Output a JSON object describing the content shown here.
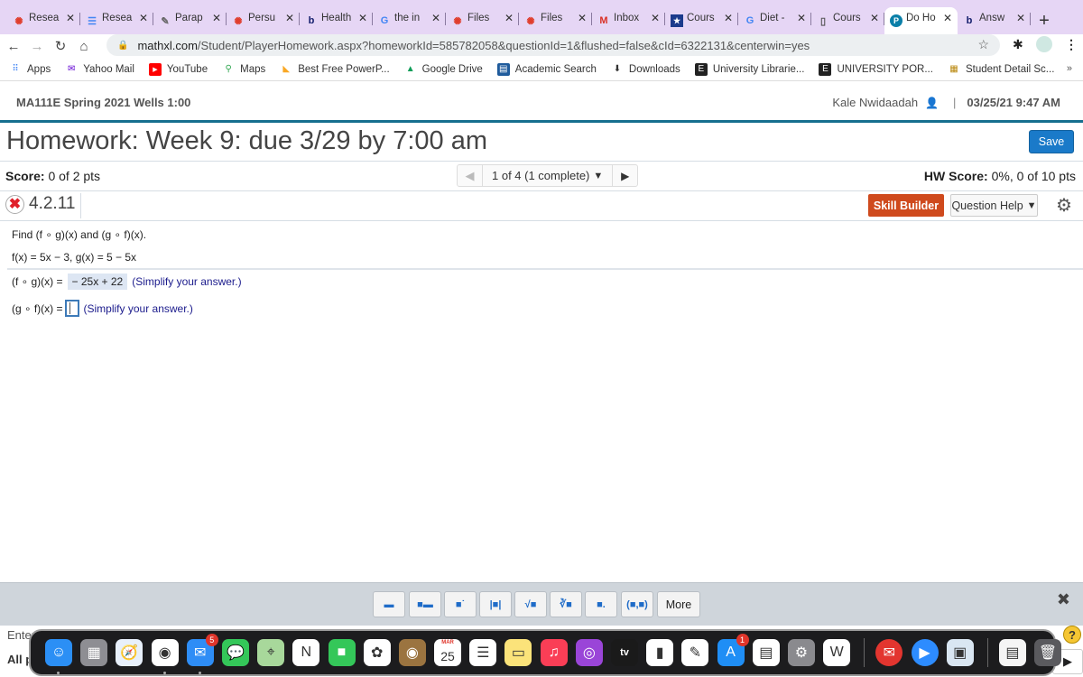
{
  "browser": {
    "tabs": [
      {
        "label": "Resea",
        "icon": "canvas-icon",
        "icon_color": "#e03e2d",
        "active": false
      },
      {
        "label": "Resea",
        "icon": "google-docs-icon",
        "icon_color": "#4285f4",
        "active": false
      },
      {
        "label": "Parap",
        "icon": "quill-icon",
        "icon_color": "#666666",
        "active": false
      },
      {
        "label": "Persu",
        "icon": "canvas-icon",
        "icon_color": "#e03e2d",
        "active": false
      },
      {
        "label": "Health",
        "icon": "bartleby-icon",
        "icon_color": "#111c6b",
        "active": false
      },
      {
        "label": "the in",
        "icon": "google-icon",
        "icon_color": "#4285f4",
        "active": false
      },
      {
        "label": "Files",
        "icon": "canvas-icon",
        "icon_color": "#e03e2d",
        "active": false
      },
      {
        "label": "Files",
        "icon": "canvas-icon",
        "icon_color": "#e03e2d",
        "active": false
      },
      {
        "label": "Inbox",
        "icon": "gmail-icon",
        "icon_color": "#d93025",
        "active": false
      },
      {
        "label": "Cours",
        "icon": "shield-star-icon",
        "icon_color": "#1b3a8c",
        "active": false
      },
      {
        "label": "Diet -",
        "icon": "google-icon",
        "icon_color": "#4285f4",
        "active": false
      },
      {
        "label": "Cours",
        "icon": "tablet-icon",
        "icon_color": "#555555",
        "active": false
      },
      {
        "label": "Do Ho",
        "icon": "pearson-icon",
        "icon_color": "#0a7fa8",
        "active": true
      },
      {
        "label": "Answ",
        "icon": "bartleby-icon",
        "icon_color": "#111c6b",
        "active": false
      }
    ],
    "tab_close_glyph": "✕",
    "new_tab_glyph": "+",
    "url_host": "mathxl.com",
    "url_path": "/Student/PlayerHomework.aspx?homeworkId=585782058&questionId=1&flushed=false&cId=6322131&centerwin=yes",
    "bookmarks": [
      {
        "label": "Apps",
        "icon": "apps-grid-icon",
        "color": "#4285f4"
      },
      {
        "label": "Yahoo Mail",
        "icon": "yahoo-mail-icon",
        "color": "#6001d2"
      },
      {
        "label": "YouTube",
        "icon": "youtube-icon",
        "color": "#ff0000"
      },
      {
        "label": "Maps",
        "icon": "maps-pin-icon",
        "color": "#34a853"
      },
      {
        "label": "Best Free PowerP...",
        "icon": "bookmark-folder-icon",
        "color": "#f9a825"
      },
      {
        "label": "Google Drive",
        "icon": "google-drive-icon",
        "color": "#0f9d58"
      },
      {
        "label": "Academic Search",
        "icon": "ebsco-icon",
        "color": "#1f5b9c"
      },
      {
        "label": "Downloads",
        "icon": "download-icon",
        "color": "#333333"
      },
      {
        "label": "University Librarie...",
        "icon": "university-e-icon",
        "color": "#222222"
      },
      {
        "label": "UNIVERSITY POR...",
        "icon": "university-e-icon",
        "color": "#222222"
      },
      {
        "label": "Student Detail Sc...",
        "icon": "student-detail-icon",
        "color": "#b8860b"
      }
    ],
    "bookmarks_overflow": "»"
  },
  "header": {
    "course": "MA111E Spring 2021 Wells 1:00",
    "user": "Kale Nwidaadah",
    "timestamp": "03/25/21 9:47 AM"
  },
  "homework": {
    "title": "Homework: Week 9: due 3/29 by 7:00 am",
    "save_label": "Save",
    "score_label": "Score:",
    "score_value": "0 of 2 pts",
    "nav_text": "1 of 4 (1 complete)",
    "hw_score_label": "HW Score:",
    "hw_score_value": "0%, 0 of 10 pts",
    "question_id": "4.2.11",
    "question_status": "incorrect",
    "skill_builder_label": "Skill Builder",
    "question_help_label": "Question Help",
    "accent_colors": {
      "save": "#1a7ac9",
      "skill_builder": "#cf4a1d",
      "header_rule": "#166f8f"
    }
  },
  "question": {
    "prompt": "Find (f ∘ g)(x) and (g ∘ f)(x).",
    "functions": "f(x) = 5x − 3,  g(x) = 5 − 5x",
    "part1_label": "(f ∘ g)(x) =",
    "part1_answer": "− 25x + 22",
    "part1_hint": "(Simplify your answer.)",
    "part2_label": "(g ∘ f)(x) =",
    "part2_answer": "",
    "part2_hint": "(Simplify your answer.)"
  },
  "math_toolbar": {
    "buttons": [
      {
        "name": "fraction-button",
        "glyph": "▬"
      },
      {
        "name": "mixed-number-button",
        "glyph": "■▬"
      },
      {
        "name": "exponent-button",
        "glyph": "■˙"
      },
      {
        "name": "absolute-value-button",
        "glyph": "|■|"
      },
      {
        "name": "square-root-button",
        "glyph": "√■"
      },
      {
        "name": "nth-root-button",
        "glyph": "∛■"
      },
      {
        "name": "subscript-button",
        "glyph": "■."
      },
      {
        "name": "ordered-pair-button",
        "glyph": "(■,■)"
      }
    ],
    "more_label": "More",
    "close_glyph": "✖"
  },
  "bottom": {
    "enter_label": "Enter",
    "all_label": "All p",
    "help_glyph": "?",
    "play_glyph": "▶"
  },
  "dock": {
    "apps": [
      {
        "name": "finder",
        "bg": "#2b8ff5",
        "glyph": "☺",
        "running": true
      },
      {
        "name": "launchpad",
        "bg": "#8e8e93",
        "glyph": "▦",
        "running": false
      },
      {
        "name": "safari",
        "bg": "#e8f0fb",
        "glyph": "🧭",
        "running": false
      },
      {
        "name": "chrome",
        "bg": "#ffffff",
        "glyph": "◉",
        "running": true
      },
      {
        "name": "mail",
        "bg": "#2e8df6",
        "glyph": "✉",
        "badge": "5",
        "running": true
      },
      {
        "name": "messages",
        "bg": "#34c759",
        "glyph": "💬",
        "running": false
      },
      {
        "name": "maps",
        "bg": "#a8d89b",
        "glyph": "⌖",
        "running": false
      },
      {
        "name": "news",
        "bg": "#ffffff",
        "glyph": "N",
        "running": false
      },
      {
        "name": "facetime",
        "bg": "#34c759",
        "glyph": "■",
        "running": false
      },
      {
        "name": "photos",
        "bg": "#ffffff",
        "glyph": "✿",
        "running": false
      },
      {
        "name": "contacts",
        "bg": "#9b7440",
        "glyph": "◉",
        "running": false
      },
      {
        "name": "calendar",
        "bg": "#ffffff",
        "glyph": "25",
        "month": "MAR",
        "running": false
      },
      {
        "name": "reminders",
        "bg": "#ffffff",
        "glyph": "☰",
        "running": false
      },
      {
        "name": "notes",
        "bg": "#fbe37a",
        "glyph": "▭",
        "running": false
      },
      {
        "name": "music",
        "bg": "#fa3e56",
        "glyph": "♫",
        "running": false
      },
      {
        "name": "podcasts",
        "bg": "#9a45d8",
        "glyph": "◎",
        "running": false
      },
      {
        "name": "apple-tv",
        "bg": "#1a1a1a",
        "glyph": "tv",
        "running": false
      },
      {
        "name": "numbers",
        "bg": "#ffffff",
        "glyph": "▮",
        "running": false
      },
      {
        "name": "pages",
        "bg": "#ffffff",
        "glyph": "✎",
        "running": false
      },
      {
        "name": "app-store",
        "bg": "#1f8ef5",
        "glyph": "A",
        "badge": "1",
        "running": false
      },
      {
        "name": "keynote",
        "bg": "#ffffff",
        "glyph": "▤",
        "running": false
      },
      {
        "name": "system-preferences",
        "bg": "#8a8a8e",
        "glyph": "⚙",
        "running": false
      },
      {
        "name": "wps-office",
        "bg": "#ffffff",
        "glyph": "W",
        "running": false
      }
    ],
    "apps2": [
      {
        "name": "airmail",
        "bg": "#e3352f",
        "glyph": "✉",
        "running": false
      },
      {
        "name": "zoom",
        "bg": "#2d8cff",
        "glyph": "▶",
        "running": false
      },
      {
        "name": "preview",
        "bg": "#d9e6f2",
        "glyph": "▣",
        "running": false
      }
    ],
    "apps3": [
      {
        "name": "chrome-window",
        "bg": "#f5f5f5",
        "glyph": "▤",
        "running": false
      },
      {
        "name": "trash",
        "bg": "#5a5a5e",
        "glyph": "🗑",
        "running": false
      }
    ]
  }
}
